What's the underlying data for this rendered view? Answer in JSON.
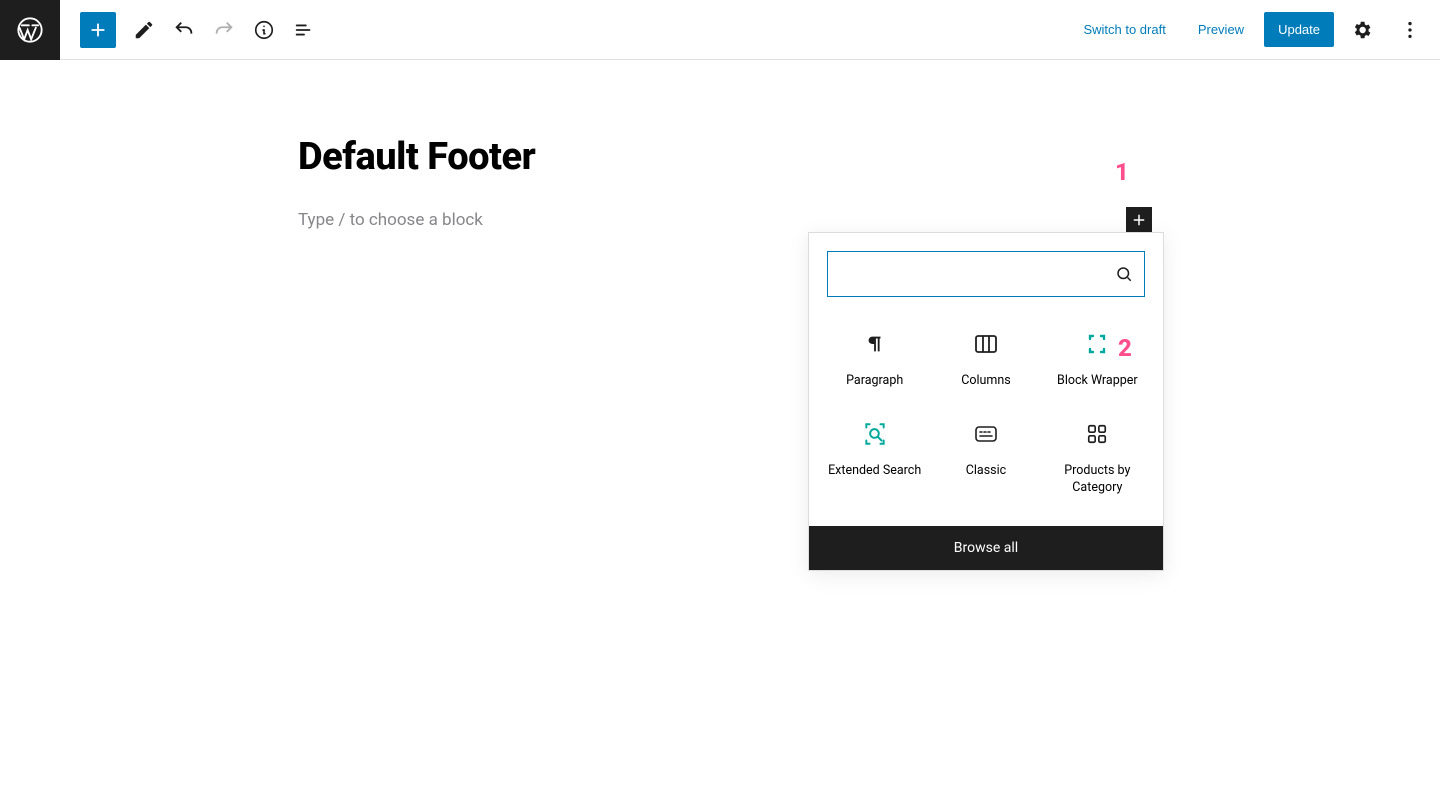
{
  "toolbar": {
    "switch_to_draft": "Switch to draft",
    "preview": "Preview",
    "update": "Update"
  },
  "editor": {
    "title": "Default Footer",
    "placeholder": "Type / to choose a block"
  },
  "block_inserter": {
    "search_value": "",
    "blocks": [
      {
        "label": "Paragraph"
      },
      {
        "label": "Columns"
      },
      {
        "label": "Block Wrapper"
      },
      {
        "label": "Extended Search"
      },
      {
        "label": "Classic"
      },
      {
        "label": "Products by Category"
      }
    ],
    "browse_all": "Browse all"
  },
  "annotations": {
    "a1": "1",
    "a2": "2"
  },
  "colors": {
    "accent": "#007cba",
    "teal": "#00a99d"
  }
}
